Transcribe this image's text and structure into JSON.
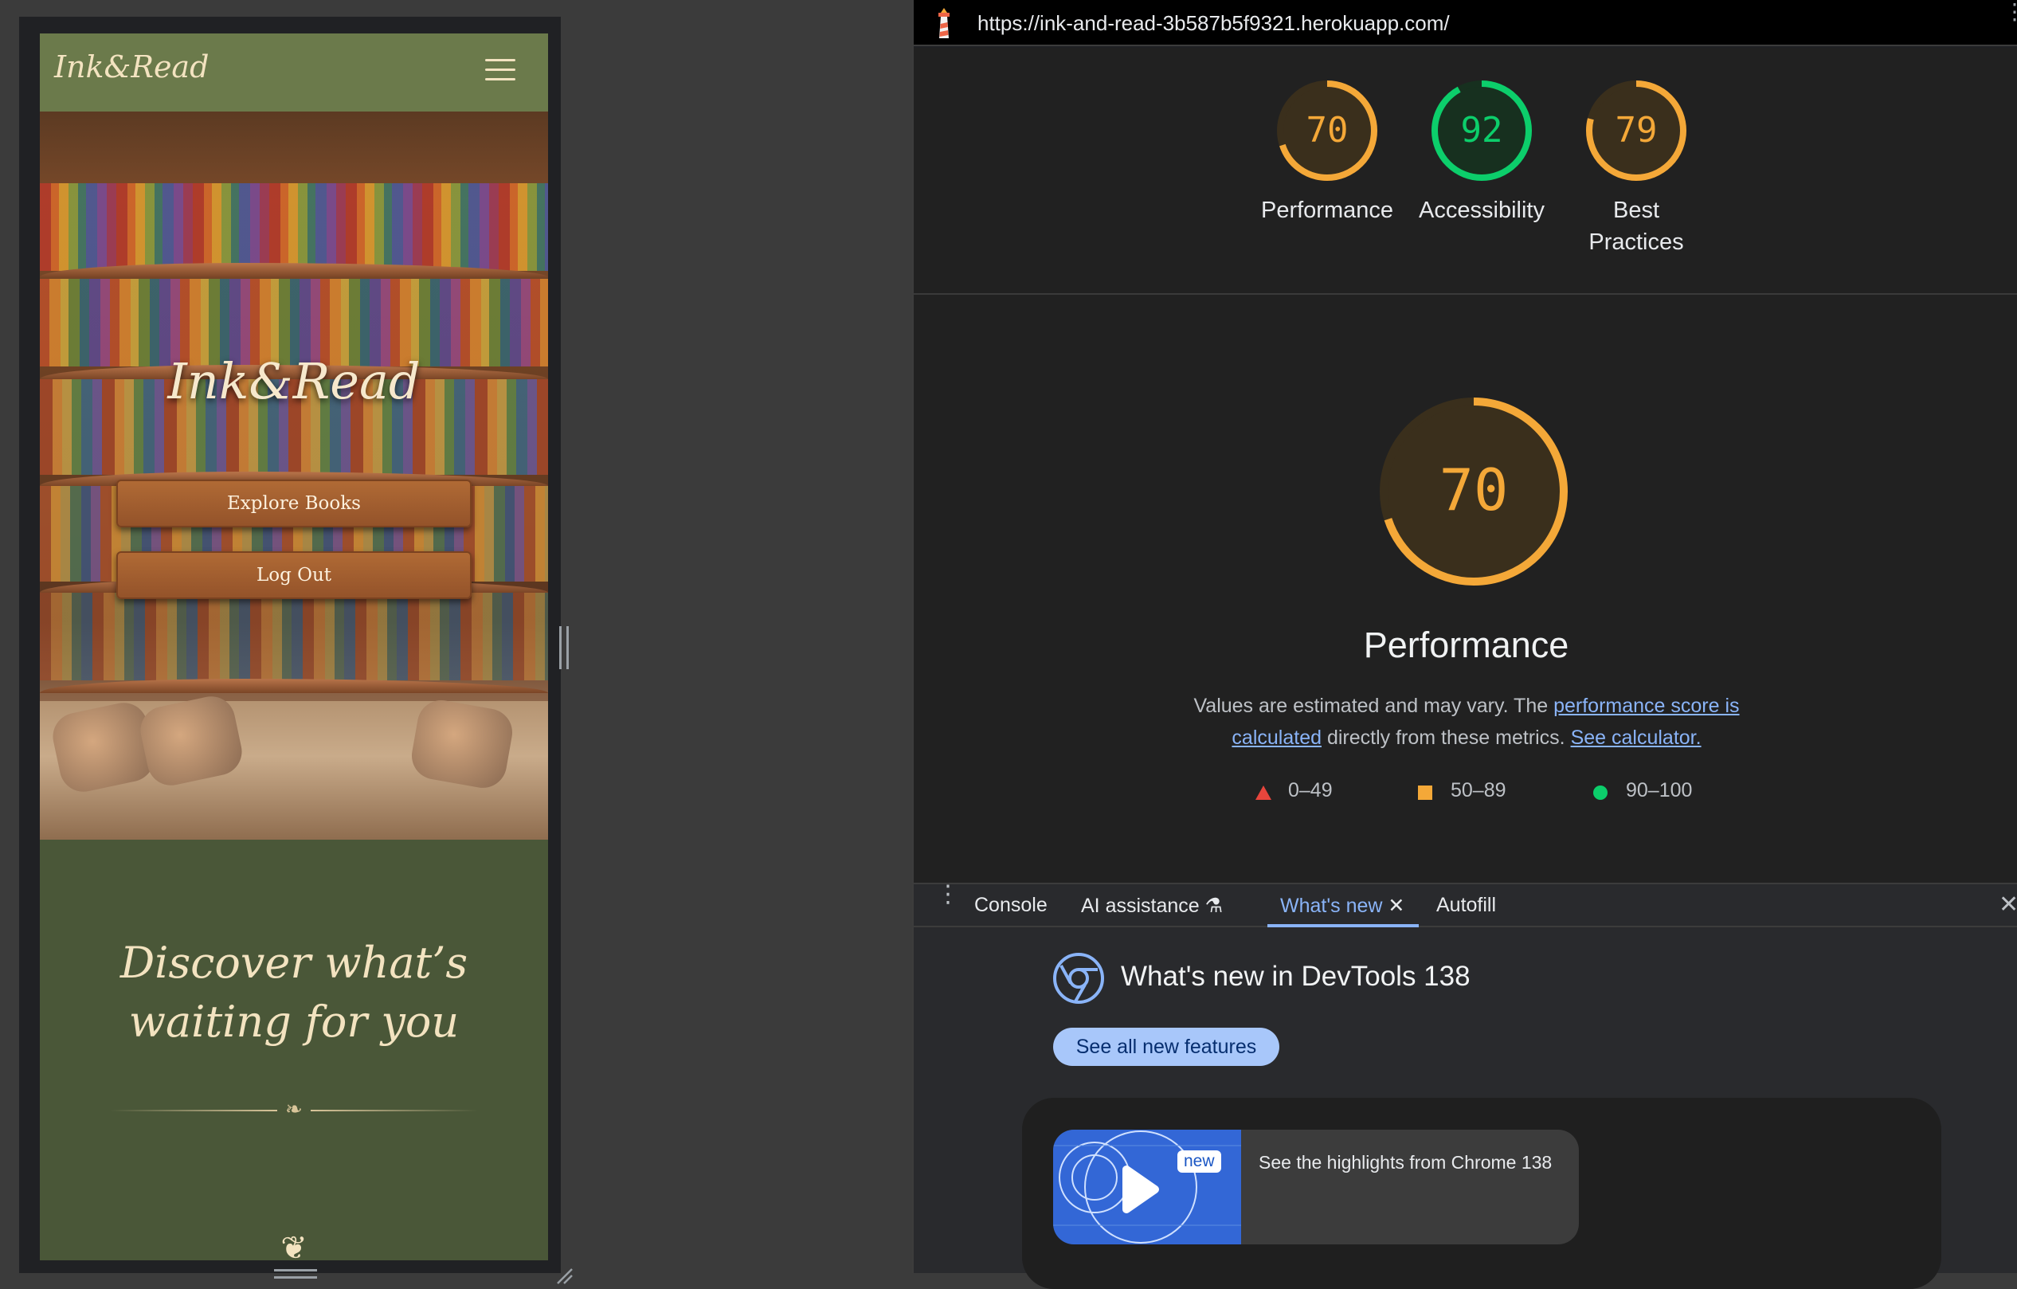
{
  "site": {
    "logo": "Ink&Read",
    "hero_title": "Ink&Read",
    "buttons": {
      "explore": "Explore Books",
      "logout": "Log Out"
    },
    "discover_heading": "Discover what’s waiting for you",
    "divider_glyph": "❧",
    "bottom_glyph": "❦"
  },
  "devtools": {
    "url": "https://ink-and-read-3b587b5f9321.herokuapp.com/",
    "colors": {
      "average": "#f4a838",
      "pass": "#0cce6b",
      "fail": "#e8453c",
      "link": "#8ab4f8"
    },
    "scores": [
      {
        "label": "Performance",
        "value": "70",
        "score": 70,
        "rating": "average"
      },
      {
        "label": "Accessibility",
        "value": "92",
        "score": 92,
        "rating": "pass"
      },
      {
        "label": "Best Practices",
        "value": "79",
        "score": 79,
        "rating": "average"
      }
    ],
    "main_gauge": {
      "value": "70",
      "score": 70,
      "title": "Performance"
    },
    "description": {
      "before": "Values are estimated and may vary. The ",
      "link1": "performance score is calculated",
      "middle": " directly from these metrics. ",
      "link2": "See calculator."
    },
    "legend": [
      {
        "shape": "triangle",
        "range": "0–49"
      },
      {
        "shape": "square",
        "range": "50–89"
      },
      {
        "shape": "circle",
        "range": "90–100"
      }
    ],
    "drawer_tabs": {
      "console": "Console",
      "ai": "AI assistance",
      "whats_new": "What's new",
      "autofill": "Autofill"
    },
    "whats_new": {
      "title": "What's new in DevTools 138",
      "see_all": "See all new features",
      "badge": "new",
      "video_text": "See the highlights from Chrome 138"
    }
  }
}
